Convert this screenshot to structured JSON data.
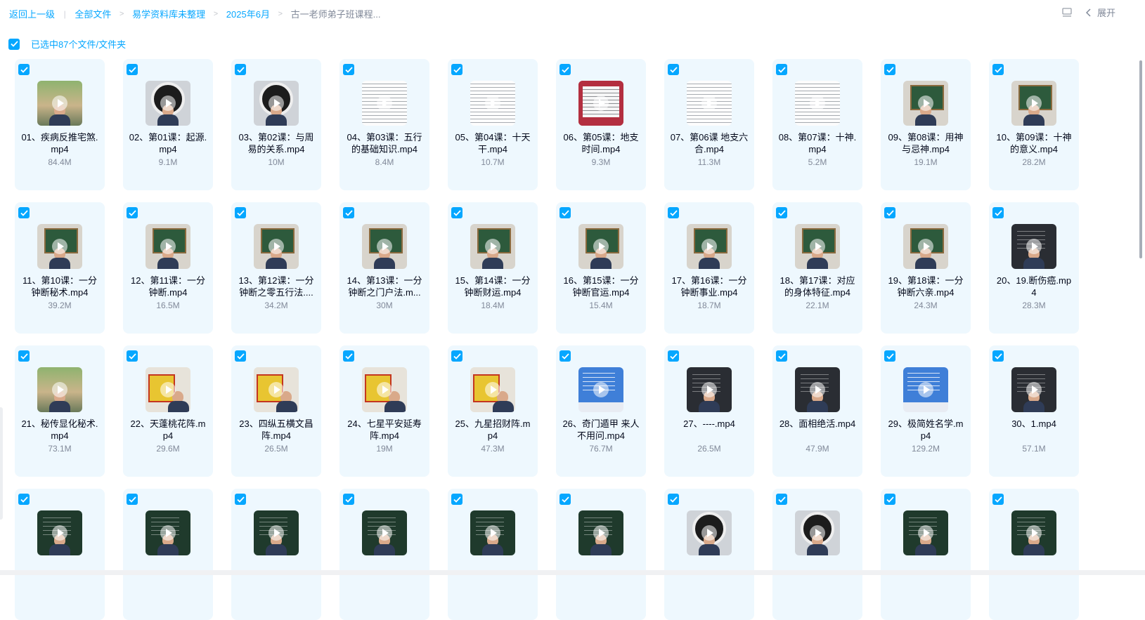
{
  "breadcrumb": {
    "back": "返回上一级",
    "items": [
      "全部文件",
      "易学资料库未整理",
      "2025年6月"
    ],
    "current": "古一老师弟子班课程..."
  },
  "toolbar": {
    "expand_label": "展开"
  },
  "selection": {
    "text": "已选中87个文件/文件夹"
  },
  "files": [
    {
      "name": "01、疾病反推宅煞.mp4",
      "size": "84.4M",
      "thumb": "outdoor"
    },
    {
      "name": "02、第01课：起源.mp4",
      "size": "9.1M",
      "thumb": "yinyang"
    },
    {
      "name": "03、第02课：与周易的关系.mp4",
      "size": "10M",
      "thumb": "yinyang"
    },
    {
      "name": "04、第03课：五行的基础知识.mp4",
      "size": "8.4M",
      "thumb": "diagram"
    },
    {
      "name": "05、第04课：十天干.mp4",
      "size": "10.7M",
      "thumb": "doc"
    },
    {
      "name": "06、第05课：地支时间.mp4",
      "size": "9.3M",
      "thumb": "red"
    },
    {
      "name": "07、第06课 地支六合.mp4",
      "size": "11.3M",
      "thumb": "doc"
    },
    {
      "name": "08、第07课：十神.mp4",
      "size": "5.2M",
      "thumb": "diagram"
    },
    {
      "name": "09、第08课：用神与忌神.mp4",
      "size": "19.1M",
      "thumb": "board"
    },
    {
      "name": "10、第09课：十神的意义.mp4",
      "size": "28.2M",
      "thumb": "board"
    },
    {
      "name": "11、第10课：一分钟断秘术.mp4",
      "size": "39.2M",
      "thumb": "board"
    },
    {
      "name": "12、第11课：一分钟断.mp4",
      "size": "16.5M",
      "thumb": "board"
    },
    {
      "name": "13、第12课：一分钟断之零五行法....",
      "size": "34.2M",
      "thumb": "board"
    },
    {
      "name": "14、第13课：一分钟断之门户法.m...",
      "size": "30M",
      "thumb": "board"
    },
    {
      "name": "15、第14课：一分钟断财运.mp4",
      "size": "18.4M",
      "thumb": "board"
    },
    {
      "name": "16、第15课：一分钟断官运.mp4",
      "size": "15.4M",
      "thumb": "board"
    },
    {
      "name": "17、第16课：一分钟断事业.mp4",
      "size": "18.7M",
      "thumb": "board"
    },
    {
      "name": "18、第17课：对应的身体特征.mp4",
      "size": "22.1M",
      "thumb": "board"
    },
    {
      "name": "19、第18课：一分钟断六亲.mp4",
      "size": "24.3M",
      "thumb": "board"
    },
    {
      "name": "20、19.断伤癌.mp4",
      "size": "28.3M",
      "thumb": "dark"
    },
    {
      "name": "21、秘传显化秘术.mp4",
      "size": "73.1M",
      "thumb": "outdoor"
    },
    {
      "name": "22、天蓬桃花阵.mp4",
      "size": "29.6M",
      "thumb": "poster"
    },
    {
      "name": "23、四纵五横文昌阵.mp4",
      "size": "26.5M",
      "thumb": "poster"
    },
    {
      "name": "24、七星平安延寿阵.mp4",
      "size": "19M",
      "thumb": "poster"
    },
    {
      "name": "25、九星招财阵.mp4",
      "size": "47.3M",
      "thumb": "poster"
    },
    {
      "name": "26、奇门遁甲 来人不用问.mp4",
      "size": "76.7M",
      "thumb": "slide"
    },
    {
      "name": "27、----.mp4",
      "size": "26.5M",
      "thumb": "dark"
    },
    {
      "name": "28、面相绝活.mp4",
      "size": "47.9M",
      "thumb": "dark"
    },
    {
      "name": "29、极简姓名学.mp4",
      "size": "129.2M",
      "thumb": "slide"
    },
    {
      "name": "30、1.mp4",
      "size": "57.1M",
      "thumb": "dark"
    },
    {
      "name": "",
      "size": "",
      "thumb": "greenboard"
    },
    {
      "name": "",
      "size": "",
      "thumb": "greenboard"
    },
    {
      "name": "",
      "size": "",
      "thumb": "greenboard"
    },
    {
      "name": "",
      "size": "",
      "thumb": "greenboard"
    },
    {
      "name": "",
      "size": "",
      "thumb": "greenboard"
    },
    {
      "name": "",
      "size": "",
      "thumb": "greenboard"
    },
    {
      "name": "",
      "size": "",
      "thumb": "yinyang"
    },
    {
      "name": "",
      "size": "",
      "thumb": "yinyang"
    },
    {
      "name": "",
      "size": "",
      "thumb": "greenboard"
    },
    {
      "name": "",
      "size": "",
      "thumb": "greenboard"
    }
  ],
  "theme": {
    "accent": "#06a7ff",
    "card_bg": "#eef8fe",
    "text": "#03081a",
    "muted": "#818999"
  }
}
